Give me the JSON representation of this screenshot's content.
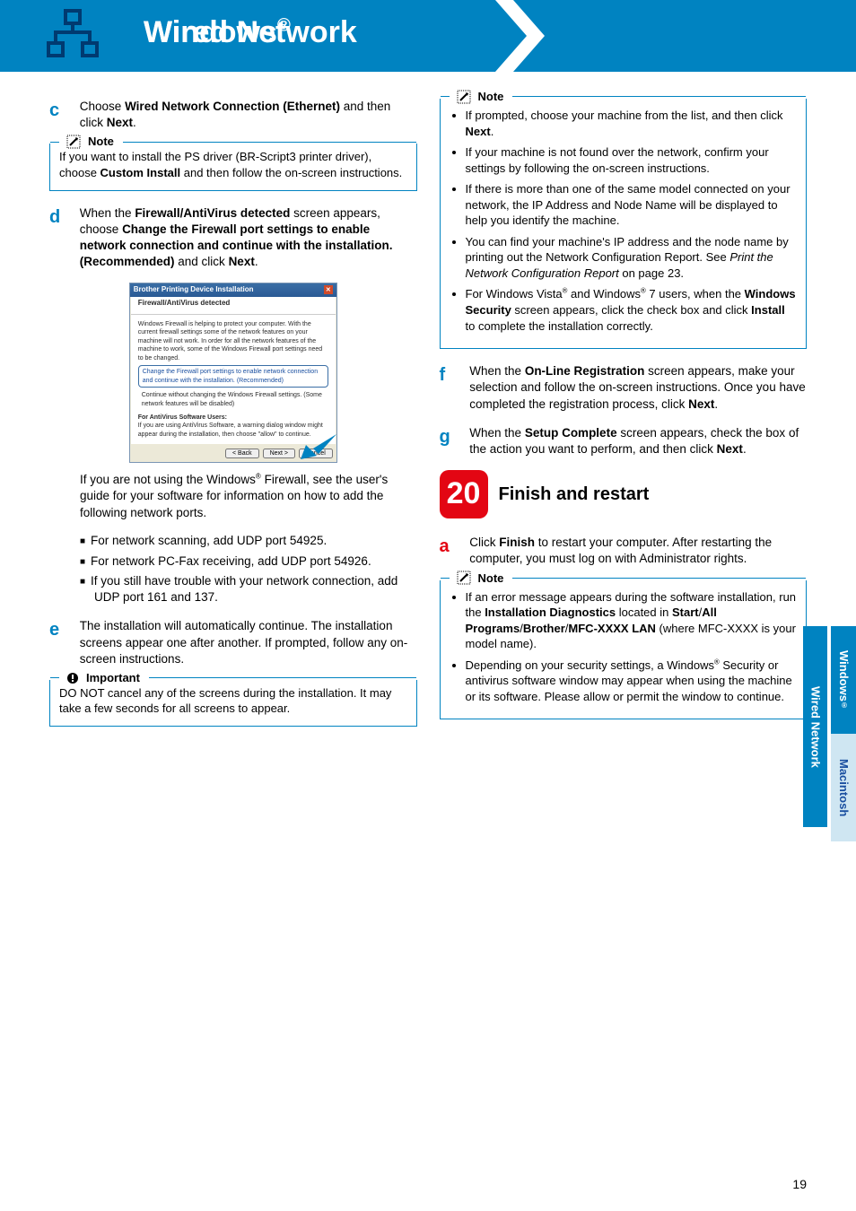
{
  "header": {
    "title": "Wired Network",
    "os": "Windows",
    "reg": "®"
  },
  "left": {
    "step_c_letter": "c",
    "step_c_pre": "Choose ",
    "step_c_b1": "Wired Network Connection (Ethernet)",
    "step_c_mid": " and then click ",
    "step_c_b2": "Next",
    "step_c_post": ".",
    "note1_label": "Note",
    "note1_text_pre": "If you want to install the PS driver (BR-Script3 printer driver), choose ",
    "note1_text_b": "Custom Install",
    "note1_text_post": " and then follow the on-screen instructions.",
    "step_d_letter": "d",
    "step_d_pre": "When the ",
    "step_d_b1": "Firewall/AntiVirus detected",
    "step_d_mid1": " screen appears, choose ",
    "step_d_b2": "Change the Firewall port settings to enable network connection and continue with the installation. (Recommended)",
    "step_d_mid2": " and click ",
    "step_d_b3": "Next",
    "step_d_post": ".",
    "mock_title": "Brother Printing Device Installation",
    "mock_sub": "Firewall/AntiVirus detected",
    "mock_p1": "Windows Firewall is helping to protect your computer. With the current firewall settings some of the network features on your machine will not work. In order for all the network features of the machine to work, some of the Windows Firewall port settings need to be changed.",
    "mock_r1": "Change the Firewall port settings to enable network connection and continue with the installation. (Recommended)",
    "mock_r2": "Continue without changing the Windows Firewall settings. (Some network features will be disabled)",
    "mock_av_h": "For AntiVirus Software Users:",
    "mock_av_t": "If you are using AntiVirus Software, a warning dialog window might appear during the installation, then choose \"allow\" to continue.",
    "mock_back": "< Back",
    "mock_next": "Next >",
    "mock_cancel": "Cancel",
    "after_mock_pre": "If you are not using the Windows",
    "after_mock_reg": "®",
    "after_mock_post": " Firewall, see the user's guide for your software for information on how to add the following network ports.",
    "sq1": "For network scanning, add UDP port 54925.",
    "sq2": "For network PC-Fax receiving, add UDP port 54926.",
    "sq3": "If you still have trouble with your network connection, add UDP port 161 and 137.",
    "step_e_letter": "e",
    "step_e_text": "The installation will automatically continue. The installation screens appear one after another. If prompted, follow any on-screen instructions.",
    "important_label": "Important",
    "important_text": "DO NOT cancel any of the screens during the installation. It may take a few seconds for all screens to appear."
  },
  "right": {
    "note2_label": "Note",
    "note2_b1_pre": "If prompted, choose your machine from the list, and then click ",
    "note2_b1_b": "Next",
    "note2_b1_post": ".",
    "note2_b2": "If your machine is not found over the network, confirm your settings by following the on-screen instructions.",
    "note2_b3": "If there is more than one of the same model connected on your network, the IP Address and Node Name will be displayed to help you identify the machine.",
    "note2_b4_pre": "You can find your machine's IP address and the node name by printing out the Network Configuration Report. See ",
    "note2_b4_i": "Print the Network Configuration Report",
    "note2_b4_post": " on page 23.",
    "note2_b5_pre": "For Windows Vista",
    "note2_b5_reg": "®",
    "note2_b5_mid1": " and Windows",
    "note2_b5_mid2": " 7 users, when the ",
    "note2_b5_b1": "Windows Security",
    "note2_b5_mid3": " screen appears, click the check box and click ",
    "note2_b5_b2": "Install",
    "note2_b5_post": " to complete the installation correctly.",
    "step_f_letter": "f",
    "step_f_pre": "When the ",
    "step_f_b1": "On-Line Registration",
    "step_f_mid": " screen appears, make your selection and follow the on-screen instructions. Once you have completed the registration process, click ",
    "step_f_b2": "Next",
    "step_f_post": ".",
    "step_g_letter": "g",
    "step_g_pre": "When the ",
    "step_g_b1": "Setup Complete",
    "step_g_mid": " screen appears, check the box of the action you want to perform, and then click ",
    "step_g_b2": "Next",
    "step_g_post": ".",
    "bigstep_num": "20",
    "bigstep_title": "Finish and restart",
    "step_a_letter": "a",
    "step_a_pre": "Click ",
    "step_a_b": "Finish",
    "step_a_post": " to restart your computer. After restarting the computer, you must log on with Administrator rights.",
    "note3_label": "Note",
    "note3_b1_pre": "If an error message appears during the software installation, run the ",
    "note3_b1_b1": "Installation Diagnostics",
    "note3_b1_mid": " located in ",
    "note3_b1_b2": "Start",
    "note3_b1_s1": "/",
    "note3_b1_b3": "All Programs",
    "note3_b1_s2": "/",
    "note3_b1_b4": "Brother",
    "note3_b1_s3": "/",
    "note3_b1_b5": "MFC-XXXX LAN",
    "note3_b1_post": " (where MFC-XXXX is your model name).",
    "note3_b2_pre": "Depending on your security settings, a Windows",
    "note3_b2_reg": "®",
    "note3_b2_post": " Security or antivirus software window may appear when using the machine or its software. Please allow or permit the window to continue."
  },
  "tabs": {
    "net": "Wired Network",
    "win": "Windows",
    "winreg": "®",
    "mac": "Macintosh"
  },
  "page_num": "19"
}
